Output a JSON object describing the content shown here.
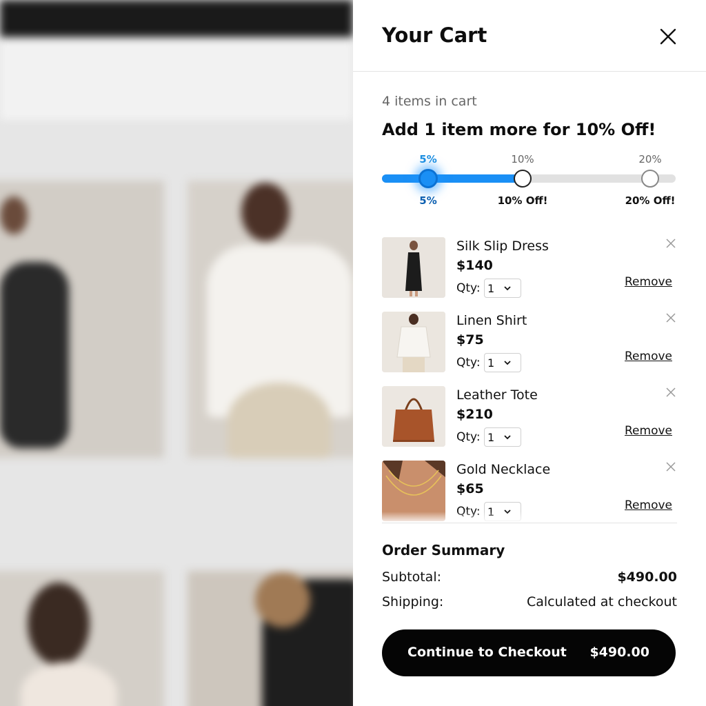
{
  "cart": {
    "title": "Your Cart",
    "count_text": "4 items in cart",
    "promo_text": "Add 1 item more for 10% Off!",
    "progress": {
      "current_label_top": "5%",
      "current_label_bottom": "5%",
      "tiers": [
        {
          "top": "10%",
          "bottom": "10% Off!"
        },
        {
          "top": "20%",
          "bottom": "20% Off!"
        }
      ]
    },
    "qty_label": "Qty:",
    "remove_label": "Remove",
    "items": [
      {
        "name": "Silk Slip Dress",
        "price": "$140",
        "qty": "1"
      },
      {
        "name": "Linen Shirt",
        "price": "$75",
        "qty": "1"
      },
      {
        "name": "Leather Tote",
        "price": "$210",
        "qty": "1"
      },
      {
        "name": "Gold Necklace",
        "price": "$65",
        "qty": "1"
      }
    ],
    "summary": {
      "title": "Order Summary",
      "subtotal_label": "Subtotal:",
      "subtotal_value": "$490.00",
      "shipping_label": "Shipping:",
      "shipping_value": "Calculated at checkout"
    },
    "checkout": {
      "label": "Continue to Checkout",
      "total": "$490.00"
    }
  },
  "colors": {
    "accent": "#1a8ff5",
    "button": "#050505"
  },
  "icons": [
    "close-icon",
    "chevron-down-icon"
  ]
}
